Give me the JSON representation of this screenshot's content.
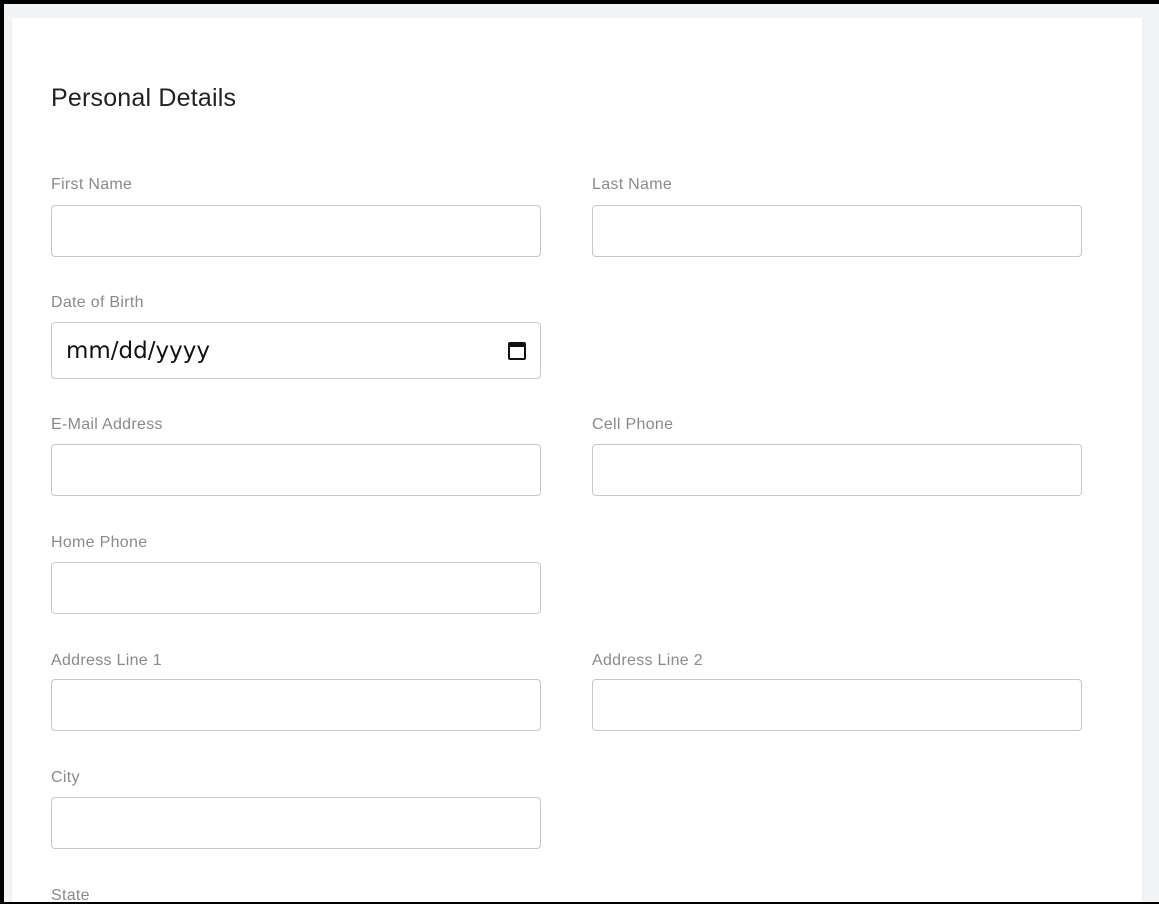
{
  "section": {
    "title": "Personal Details"
  },
  "fields": {
    "first_name": {
      "label": "First Name",
      "value": ""
    },
    "last_name": {
      "label": "Last Name",
      "value": ""
    },
    "dob": {
      "label": "Date of Birth",
      "placeholder": "mm/dd/yyyy"
    },
    "email": {
      "label": "E-Mail Address",
      "value": ""
    },
    "cell_phone": {
      "label": "Cell Phone",
      "value": ""
    },
    "home_phone": {
      "label": "Home Phone",
      "value": ""
    },
    "address1": {
      "label": "Address Line 1",
      "value": ""
    },
    "address2": {
      "label": "Address Line 2",
      "value": ""
    },
    "city": {
      "label": "City",
      "value": ""
    },
    "state": {
      "label": "State"
    }
  },
  "icons": {
    "calendar": "calendar-icon"
  },
  "colors": {
    "label": "#8a8a8a",
    "border": "#c8c8c8",
    "title": "#222222"
  }
}
